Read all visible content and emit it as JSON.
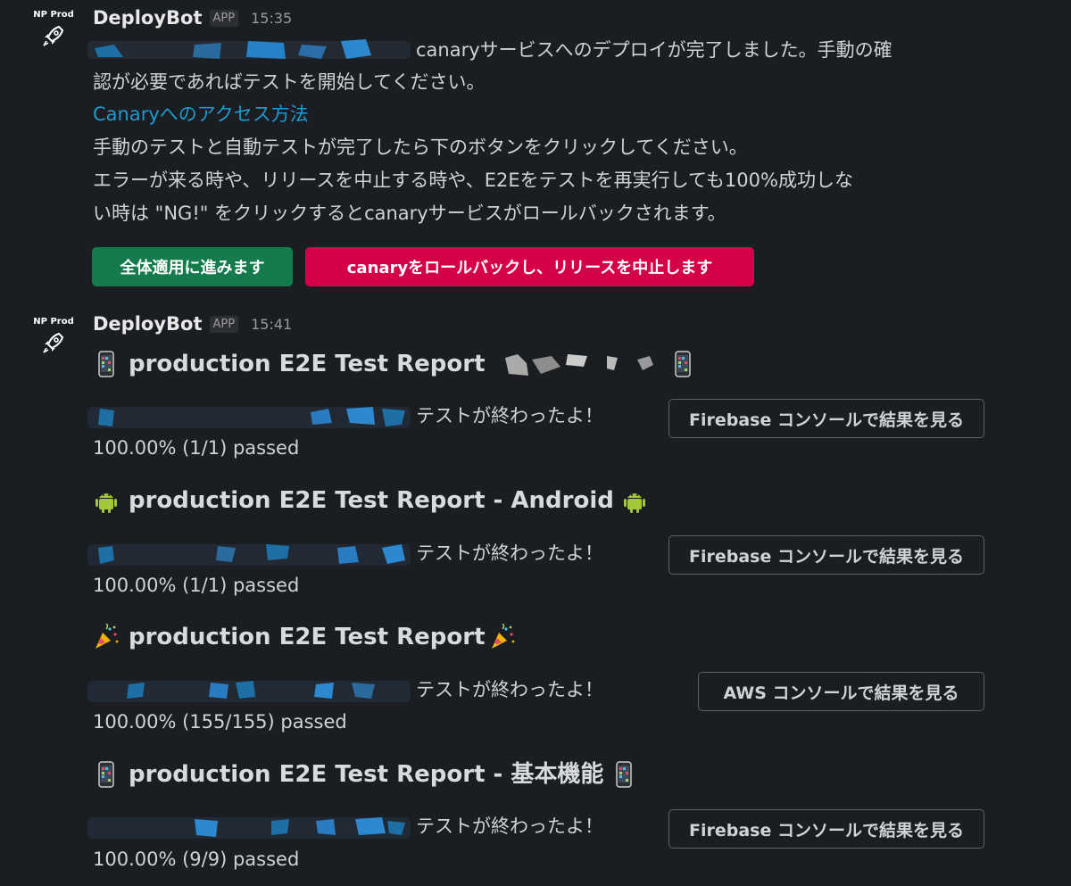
{
  "colors": {
    "background": "#1a1d21",
    "link": "#1d9bd1",
    "primary_button": "#157a4c",
    "danger_button": "#d4004a"
  },
  "message1": {
    "avatar_label": "NP Prod",
    "avatar_icon": "rocket-icon",
    "sender": "DeployBot",
    "badge": "APP",
    "time": "15:35",
    "line1": "canaryサービスへのデプロイが完了しました。手動の確",
    "line2": "認が必要であればテストを開始してください。",
    "link": "Canaryへのアクセス方法",
    "line3": "手動のテストと自動テストが完了したら下のボタンをクリックしてください。",
    "line4": "エラーが来る時や、リリースを中止する時や、E2Eをテストを再実行しても100%成功しな",
    "line5": "い時は \"NG!\" をクリックするとcanaryサービスがロールバックされます。",
    "button_proceed": "全体適用に進みます",
    "button_rollback": "canaryをロールバックし、リリースを中止します"
  },
  "message2": {
    "avatar_label": "NP Prod",
    "avatar_icon": "rocket-icon",
    "sender": "DeployBot",
    "badge": "APP",
    "time": "15:41",
    "reports": [
      {
        "title": "production E2E Test Report",
        "icon": "mobile-phone-icon",
        "suffix": "テストが終わったよ！",
        "result": "100.00% (1/1) passed",
        "button": "Firebase コンソールで結果を見る"
      },
      {
        "title": "production E2E Test Report - Android",
        "icon": "android-icon",
        "suffix": "テストが終わったよ！",
        "result": "100.00% (1/1) passed",
        "button": "Firebase コンソールで結果を見る"
      },
      {
        "title": "production E2E Test Report",
        "icon": "party-popper-icon",
        "suffix": "テストが終わったよ！",
        "result": "100.00% (155/155) passed",
        "button": "AWS コンソールで結果を見る"
      },
      {
        "title": "production E2E Test Report - 基本機能",
        "icon": "mobile-phone-icon",
        "suffix": "テストが終わったよ！",
        "result": "100.00% (9/9) passed",
        "button": "Firebase コンソールで結果を見る"
      }
    ]
  }
}
